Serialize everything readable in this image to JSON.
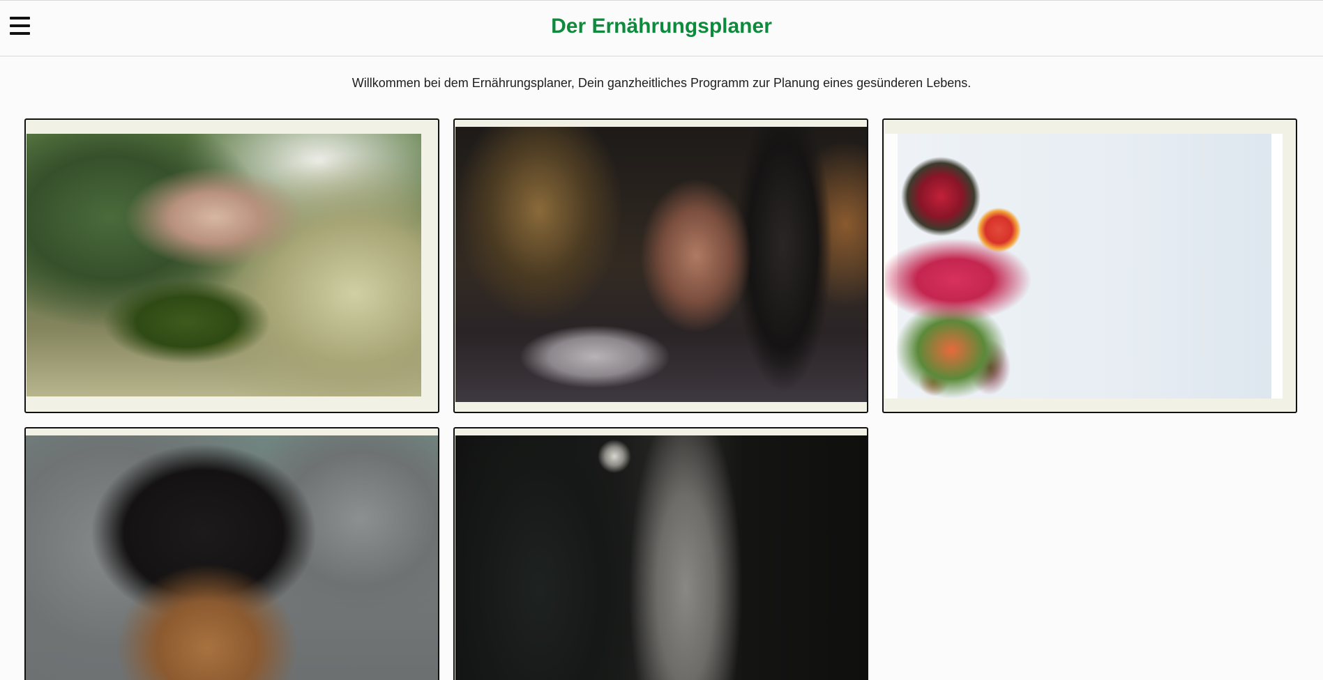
{
  "header": {
    "title": "Der Ernährungsplaner",
    "menu_icon": "hamburger-menu-icon"
  },
  "main": {
    "welcome": "Willkommen bei dem Ernährungsplaner, Dein ganzheitliches Programm zur Planung eines gesünderen Lebens.",
    "cards": [
      {
        "image": "cooking-vegetables-photo"
      },
      {
        "image": "gym-barbell-photo"
      },
      {
        "image": "fresh-fruit-photo"
      },
      {
        "image": "man-portrait-photo"
      },
      {
        "image": "dark-gym-photo"
      }
    ]
  },
  "colors": {
    "brand_green": "#0e8a3c",
    "card_background": "#f1f2e5",
    "card_border": "#111111",
    "page_background": "#fbfbfb"
  }
}
